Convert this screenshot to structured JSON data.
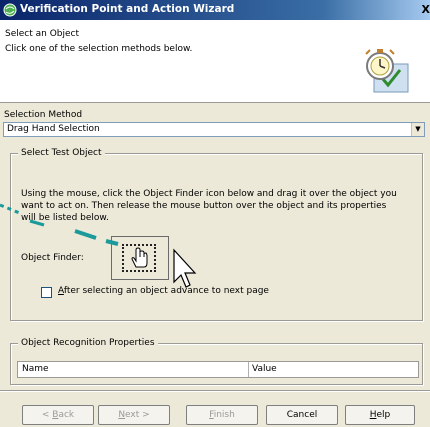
{
  "window": {
    "title": "Verification Point and Action Wizard",
    "close_glyph": "X",
    "title_icon": "wizard-globe-icon"
  },
  "header": {
    "title": "Select an Object",
    "description": "Click one of the selection methods below.",
    "illustration_icon": "stopwatch-check-icon"
  },
  "selection_method": {
    "label": "Selection Method",
    "value": "Drag Hand Selection",
    "arrow_glyph": "▼"
  },
  "select_test_object": {
    "legend": "Select Test Object",
    "instructions": "Using the mouse, click the Object Finder icon below and drag it over the object you want to act on. Then release the mouse button over the object and its properties will be listed below.",
    "finder_label": "Object Finder:",
    "finder_icon": "hand-pointer-icon",
    "checkbox_checked": false,
    "checkbox_label_underlined": "A",
    "checkbox_label_rest": "fter selecting an object advance to next page"
  },
  "recognition": {
    "legend": "Object Recognition Properties",
    "columns": [
      "Name",
      "Value"
    ]
  },
  "buttons": {
    "back": {
      "u": "B",
      "before": "< ",
      "after": "ack"
    },
    "next": {
      "u": "N",
      "before": "",
      "after": "ext >"
    },
    "finish": {
      "u": "F",
      "before": "",
      "after": "inish"
    },
    "cancel": "Cancel",
    "help": {
      "u": "H",
      "before": "",
      "after": "elp"
    }
  },
  "colors": {
    "title_bar_start": "#0a246a",
    "title_bar_end": "#a6caf0",
    "dialog_face": "#ece9d8",
    "annotation_teal": "#1a9a9a"
  }
}
